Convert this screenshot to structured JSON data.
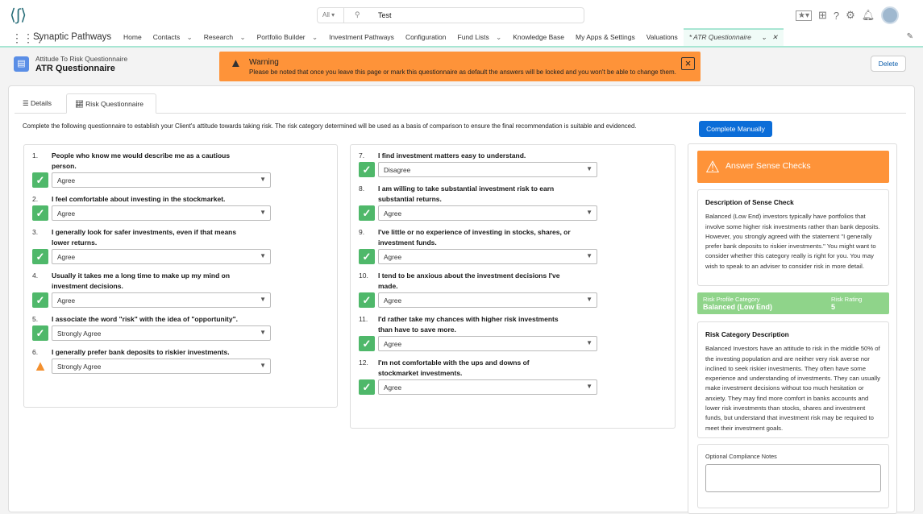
{
  "header": {
    "search_scope": "All",
    "search_value": "Test"
  },
  "nav": {
    "app_name": "Synaptic Pathways",
    "items": [
      {
        "label": "Home",
        "chevron": false
      },
      {
        "label": "Contacts",
        "chevron": true
      },
      {
        "label": "Research",
        "chevron": true
      },
      {
        "label": "Portfolio Builder",
        "chevron": true
      },
      {
        "label": "Investment Pathways",
        "chevron": false
      },
      {
        "label": "Configuration",
        "chevron": false
      },
      {
        "label": "Fund Lists",
        "chevron": true
      },
      {
        "label": "Knowledge Base",
        "chevron": false
      },
      {
        "label": "My Apps & Settings",
        "chevron": false
      },
      {
        "label": "Valuations",
        "chevron": false
      }
    ],
    "active_tab": "* ATR Questionnaire"
  },
  "page": {
    "subtitle": "Attitude To Risk Questionnaire",
    "title": "ATR Questionnaire",
    "delete_label": "Delete"
  },
  "warning": {
    "title": "Warning",
    "message": "Please be noted that once you leave this page or mark this questionnaire as default the answers will be locked and you won't be able to change them."
  },
  "tabs": {
    "details": "Details",
    "risk": "Risk Questionnaire"
  },
  "intro": "Complete the following questionnaire to establish your Client's attitude towards taking risk. The risk category determined will be used as a basis of comparison to ensure the final recommendation is suitable and evidenced.",
  "complete_manually": "Complete Manually",
  "questions": [
    {
      "n": "1.",
      "text": "People who know me would describe me as a cautious person.",
      "answer": "Agree",
      "status": "ok"
    },
    {
      "n": "2.",
      "text": "I feel comfortable about investing in the stockmarket.",
      "answer": "Agree",
      "status": "ok"
    },
    {
      "n": "3.",
      "text": "I generally look for safer investments, even if that means lower returns.",
      "answer": "Agree",
      "status": "ok"
    },
    {
      "n": "4.",
      "text": "Usually it takes me a long time to make up my mind on investment decisions.",
      "answer": "Agree",
      "status": "ok"
    },
    {
      "n": "5.",
      "text": "I associate the word \"risk\" with the idea of \"opportunity\".",
      "answer": "Strongly Agree",
      "status": "ok"
    },
    {
      "n": "6.",
      "text": "I generally prefer bank deposits to riskier investments.",
      "answer": "Strongly Agree",
      "status": "warning"
    },
    {
      "n": "7.",
      "text": "I find investment matters easy to understand.",
      "answer": "Disagree",
      "status": "ok"
    },
    {
      "n": "8.",
      "text": "I am willing to take substantial investment risk to earn substantial returns.",
      "answer": "Agree",
      "status": "ok"
    },
    {
      "n": "9.",
      "text": "I've little or no experience of investing in stocks, shares, or investment funds.",
      "answer": "Agree",
      "status": "ok"
    },
    {
      "n": "10.",
      "text": "I tend to be anxious about the investment decisions I've made.",
      "answer": "Agree",
      "status": "ok"
    },
    {
      "n": "11.",
      "text": "I'd rather take my chances with higher risk investments than have to save more.",
      "answer": "Agree",
      "status": "ok"
    },
    {
      "n": "12.",
      "text": "I'm not comfortable with the ups and downs of stockmarket investments.",
      "answer": "Agree",
      "status": "ok"
    }
  ],
  "sense": {
    "title": "Answer Sense Checks",
    "desc_title": "Description of Sense Check",
    "desc": "Balanced (Low End) investors typically have portfolios that involve some higher risk investments rather than bank deposits. However, you strongly agreed with the statement \"I generally prefer bank deposits to riskier investments.\" You might want to consider whether this category really is right for you. You may wish to speak to an adviser to consider risk in more detail."
  },
  "risk": {
    "category_label": "Risk Profile Category",
    "category": "Balanced (Low End)",
    "rating_label": "Risk Rating",
    "rating": "5"
  },
  "category_desc": {
    "title": "Risk Category Description",
    "text": "Balanced Investors have an attitude to risk in the middle 50% of the investing population and are neither very risk averse nor inclined to seek riskier investments. They often have some experience and understanding of investments. They can usually make investment decisions without too much hesitation or anxiety. They may find more comfort in banks accounts and lower risk investments than stocks, shares and investment funds, but understand that investment risk may be required to meet their investment goals."
  },
  "notes": {
    "label": "Optional Compliance Notes",
    "value": ""
  }
}
